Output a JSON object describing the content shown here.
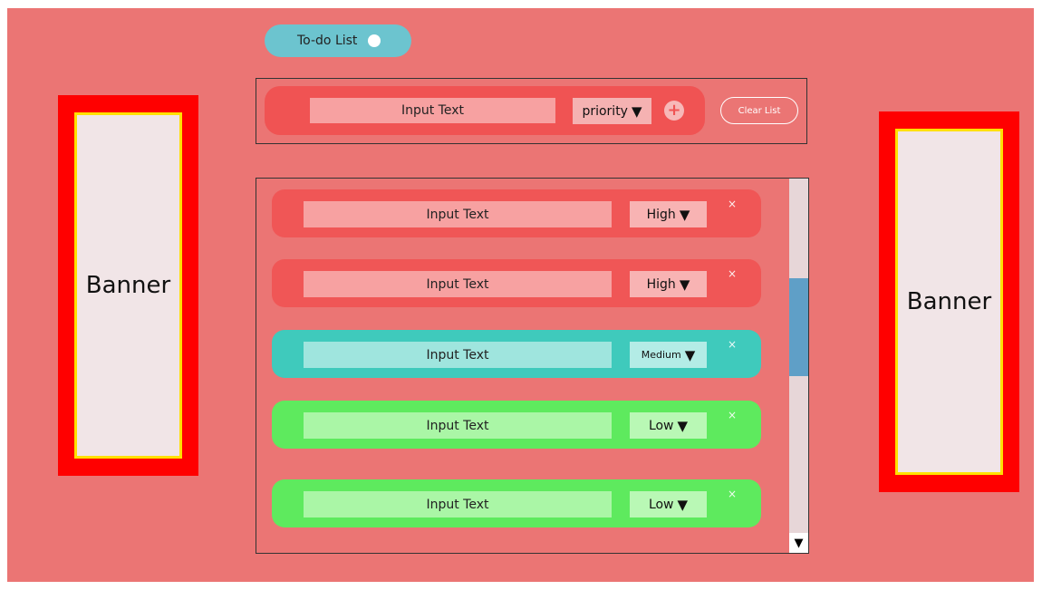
{
  "toggle": {
    "label": "To-do List"
  },
  "add_form": {
    "input_text": "Input Text",
    "priority_label": "priority",
    "add_icon": "plus-icon",
    "clear_label": "Clear List"
  },
  "tasks": [
    {
      "text": "Input Text",
      "priority": "High",
      "color": "#f05656",
      "field_color": "#f7a1a1",
      "prio_color": "#f8b3b3"
    },
    {
      "text": "Input Text",
      "priority": "High",
      "color": "#f05656",
      "field_color": "#f7a1a1",
      "prio_color": "#f8b3b3"
    },
    {
      "text": "Input Text",
      "priority": "Medium",
      "color": "#3fcabc",
      "field_color": "#9fe5de",
      "prio_color": "#b3ece6"
    },
    {
      "text": "Input Text",
      "priority": "Low",
      "color": "#5eea5e",
      "field_color": "#aaf6a6",
      "prio_color": "#b9f8b5"
    },
    {
      "text": "Input Text",
      "priority": "Low",
      "color": "#5eea5e",
      "field_color": "#aaf6a6",
      "prio_color": "#b9f8b5"
    }
  ],
  "delete_icon": "close-icon",
  "banners": {
    "left": "Banner",
    "right": "Banner"
  },
  "colors": {
    "background": "#eb7574",
    "banner_border": "#ff0000",
    "banner_inner_border": "#ffe000",
    "toggle": "#6cc4cf",
    "scroll_thumb": "#5f9fc7"
  }
}
